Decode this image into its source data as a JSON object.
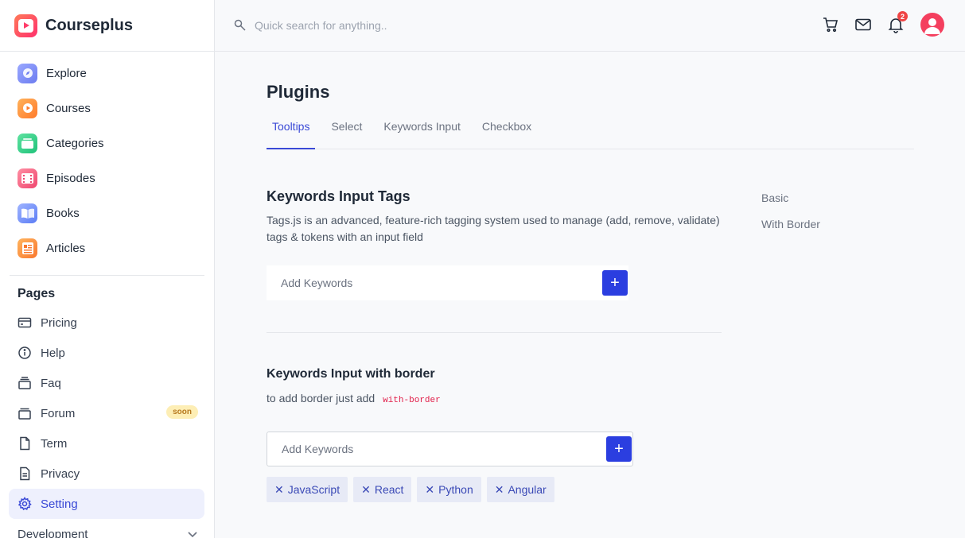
{
  "brand": {
    "name": "Courseplus"
  },
  "sidebar": {
    "main_items": [
      {
        "label": "Explore",
        "icon": "compass-icon"
      },
      {
        "label": "Courses",
        "icon": "play-icon"
      },
      {
        "label": "Categories",
        "icon": "folder-icon"
      },
      {
        "label": "Episodes",
        "icon": "film-icon"
      },
      {
        "label": "Books",
        "icon": "book-icon"
      },
      {
        "label": "Articles",
        "icon": "article-icon"
      }
    ],
    "pages_title": "Pages",
    "pages": [
      {
        "label": "Pricing",
        "icon": "card-icon"
      },
      {
        "label": "Help",
        "icon": "info-icon"
      },
      {
        "label": "Faq",
        "icon": "stack-icon"
      },
      {
        "label": "Forum",
        "icon": "forum-icon",
        "badge": "soon"
      },
      {
        "label": "Term",
        "icon": "page-icon"
      },
      {
        "label": "Privacy",
        "icon": "document-icon"
      },
      {
        "label": "Setting",
        "icon": "gear-icon",
        "active": true
      }
    ],
    "development_label": "Development"
  },
  "header": {
    "search_placeholder": "Quick search for anything..",
    "notification_count": "2"
  },
  "main": {
    "title": "Plugins",
    "tabs": [
      {
        "label": "Tooltips",
        "active": true
      },
      {
        "label": "Select"
      },
      {
        "label": "Keywords Input"
      },
      {
        "label": "Checkbox"
      }
    ],
    "section1": {
      "title": "Keywords Input Tags",
      "description": "Tags.js is an advanced, feature-rich tagging system used to manage (add, remove, validate) tags & tokens with an input field",
      "placeholder": "Add Keywords",
      "add_label": "+"
    },
    "section2": {
      "title": "Keywords Input with border",
      "description": "to add border just add",
      "code": "with-border",
      "placeholder": "Add Keywords",
      "add_label": "+",
      "tags": [
        "JavaScript",
        "React",
        "Python",
        "Angular"
      ]
    },
    "toc": [
      "Basic",
      "With Border"
    ]
  },
  "colors": {
    "accent": "#2b3ee0",
    "active_text": "#3a49d6",
    "badge_bg": "#fdeeb5",
    "notification": "#ef4444"
  }
}
